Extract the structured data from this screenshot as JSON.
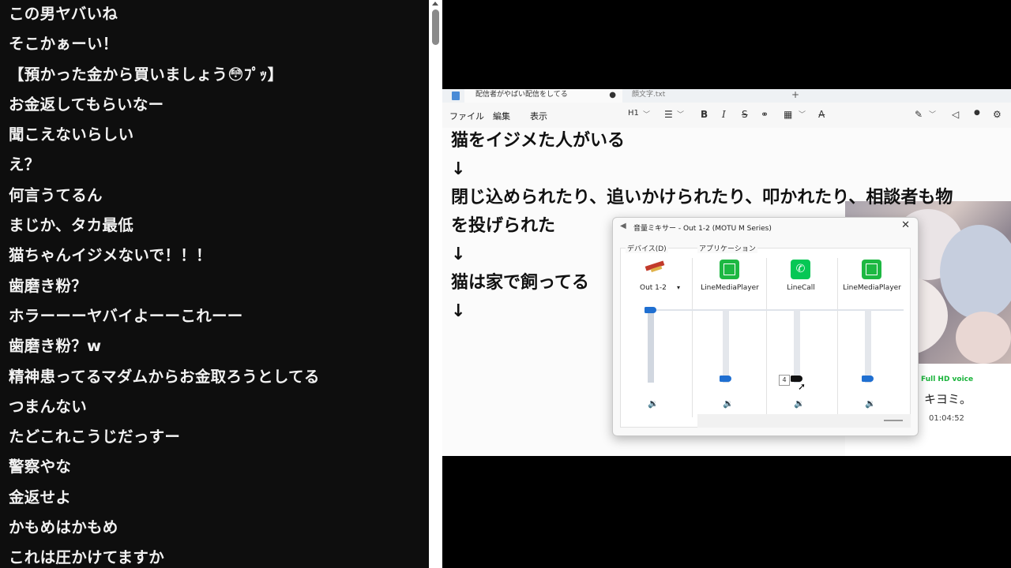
{
  "chat": {
    "comments": [
      "この男ヤバいね",
      "そこかぁーい！",
      "【預かった金から買いましょう😳ﾌﾟｯ】",
      "お金返してもらいなー",
      "聞こえないらしい",
      "え？",
      "何言うてるん",
      "まじか、タカ最低",
      "猫ちゃんイジメないで！！！",
      "歯磨き粉？",
      "ホラーーーヤバイよーーこれーー",
      "歯磨き粉？w",
      "精神患ってるマダムからお金取ろうとしてる",
      "つまんない",
      "たどこれこうじだっすー",
      "警察やな",
      "金返せよ",
      "かもめはかもめ",
      "これは圧かけてますか"
    ]
  },
  "notepad": {
    "tabs": [
      {
        "label": "配信者がやばい配信をしてる",
        "modified": "●"
      },
      {
        "label": "顔文字.txt"
      }
    ],
    "new_tab": "+",
    "menu": [
      "ファイル",
      "編集",
      "表示"
    ],
    "toolbar": {
      "heading": "H1",
      "heading_caret": "﹀",
      "list": "☰",
      "list_caret": "﹀",
      "bold": "B",
      "italic": "I",
      "strike": "S",
      "link": "⚭",
      "table": "▦",
      "table_caret": "﹀",
      "clear": "A̶",
      "copilot": "✎",
      "copilot_caret": "﹀",
      "share": "◁",
      "account": "●",
      "settings": "⚙"
    },
    "lines": [
      "猫をイジメた人がいる",
      "↓",
      "閉じ込められたり、追いかけられたり、叩かれたり、相談者も物",
      "を投げられた",
      "↓",
      "猫は家で飼ってる",
      "↓"
    ]
  },
  "call_overlay": {
    "hd_label": "Full HD voice",
    "caller": "キヨミ。",
    "duration": "01:04:52"
  },
  "mixer": {
    "title": "音量ミキサー - Out 1-2 (MOTU M Series)",
    "close": "✕",
    "device_group": "デバイス(D)",
    "app_group": "アプリケーション",
    "device_name": "Out 1-2",
    "device_caret": "▾",
    "apps": [
      {
        "name": "LineMediaPlayer",
        "icon": "media-player-icon"
      },
      {
        "name": "LineCall",
        "icon": "phone-icon",
        "glyph": "✆"
      },
      {
        "name": "LineMediaPlayer",
        "icon": "media-player-icon"
      }
    ],
    "speaker_glyph": "🔉",
    "levels": {
      "device": 1.0,
      "apps": [
        0.05,
        0.05,
        0.05
      ]
    },
    "tooltip": "4"
  },
  "colors": {
    "chat_bg": "#0e0e0e",
    "mixer_accent": "#1f6fd1",
    "line_green": "#06c755"
  }
}
